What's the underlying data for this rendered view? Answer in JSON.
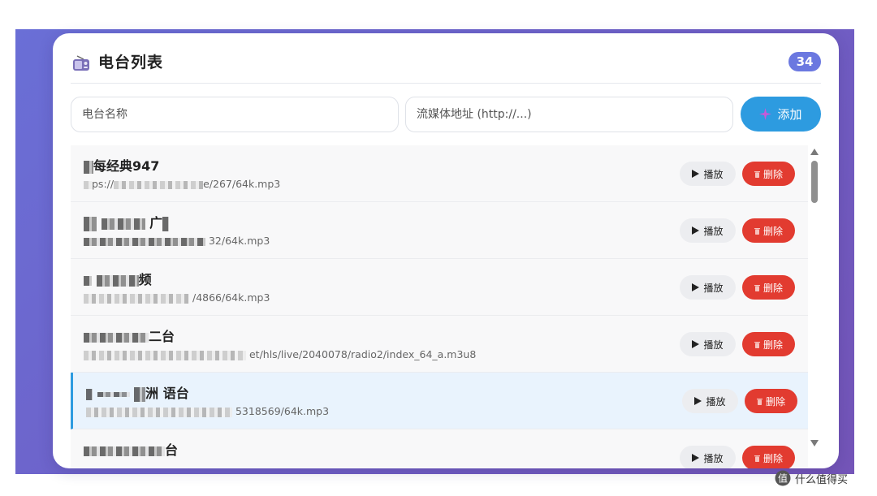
{
  "header": {
    "title": "电台列表",
    "count": "34"
  },
  "form": {
    "name_placeholder": "电台名称",
    "url_placeholder": "流媒体地址 (http://...)",
    "add_label": "添加"
  },
  "stations": [
    {
      "name_visible": "每经典947",
      "url_prefix": "ps://",
      "url_visible": "e/267/64k.mp3",
      "active": false
    },
    {
      "name_visible": "广",
      "url_prefix": "",
      "url_visible": "32/64k.mp3",
      "active": false
    },
    {
      "name_visible": "频",
      "url_prefix": "",
      "url_visible": "/4866/64k.mp3",
      "active": false
    },
    {
      "name_visible": "二台",
      "url_prefix": "",
      "url_visible": "et/hls/live/2040078/radio2/index_64_a.m3u8",
      "active": false
    },
    {
      "name_visible": "洲 语台",
      "url_prefix": "",
      "url_visible": "5318569/64k.mp3",
      "active": true
    },
    {
      "name_visible": "台",
      "url_prefix": "",
      "url_visible": "",
      "active": false
    }
  ],
  "row_actions": {
    "play_label": "播放",
    "delete_label": "删除"
  },
  "watermark": {
    "text": "什么值得买"
  },
  "colors": {
    "background_gradient_start": "#6a6fd6",
    "background_gradient_end": "#7455b8",
    "badge": "#6b78e0",
    "primary": "#2d9be0",
    "danger": "#e23b30",
    "active_row": "#e9f3fd"
  }
}
